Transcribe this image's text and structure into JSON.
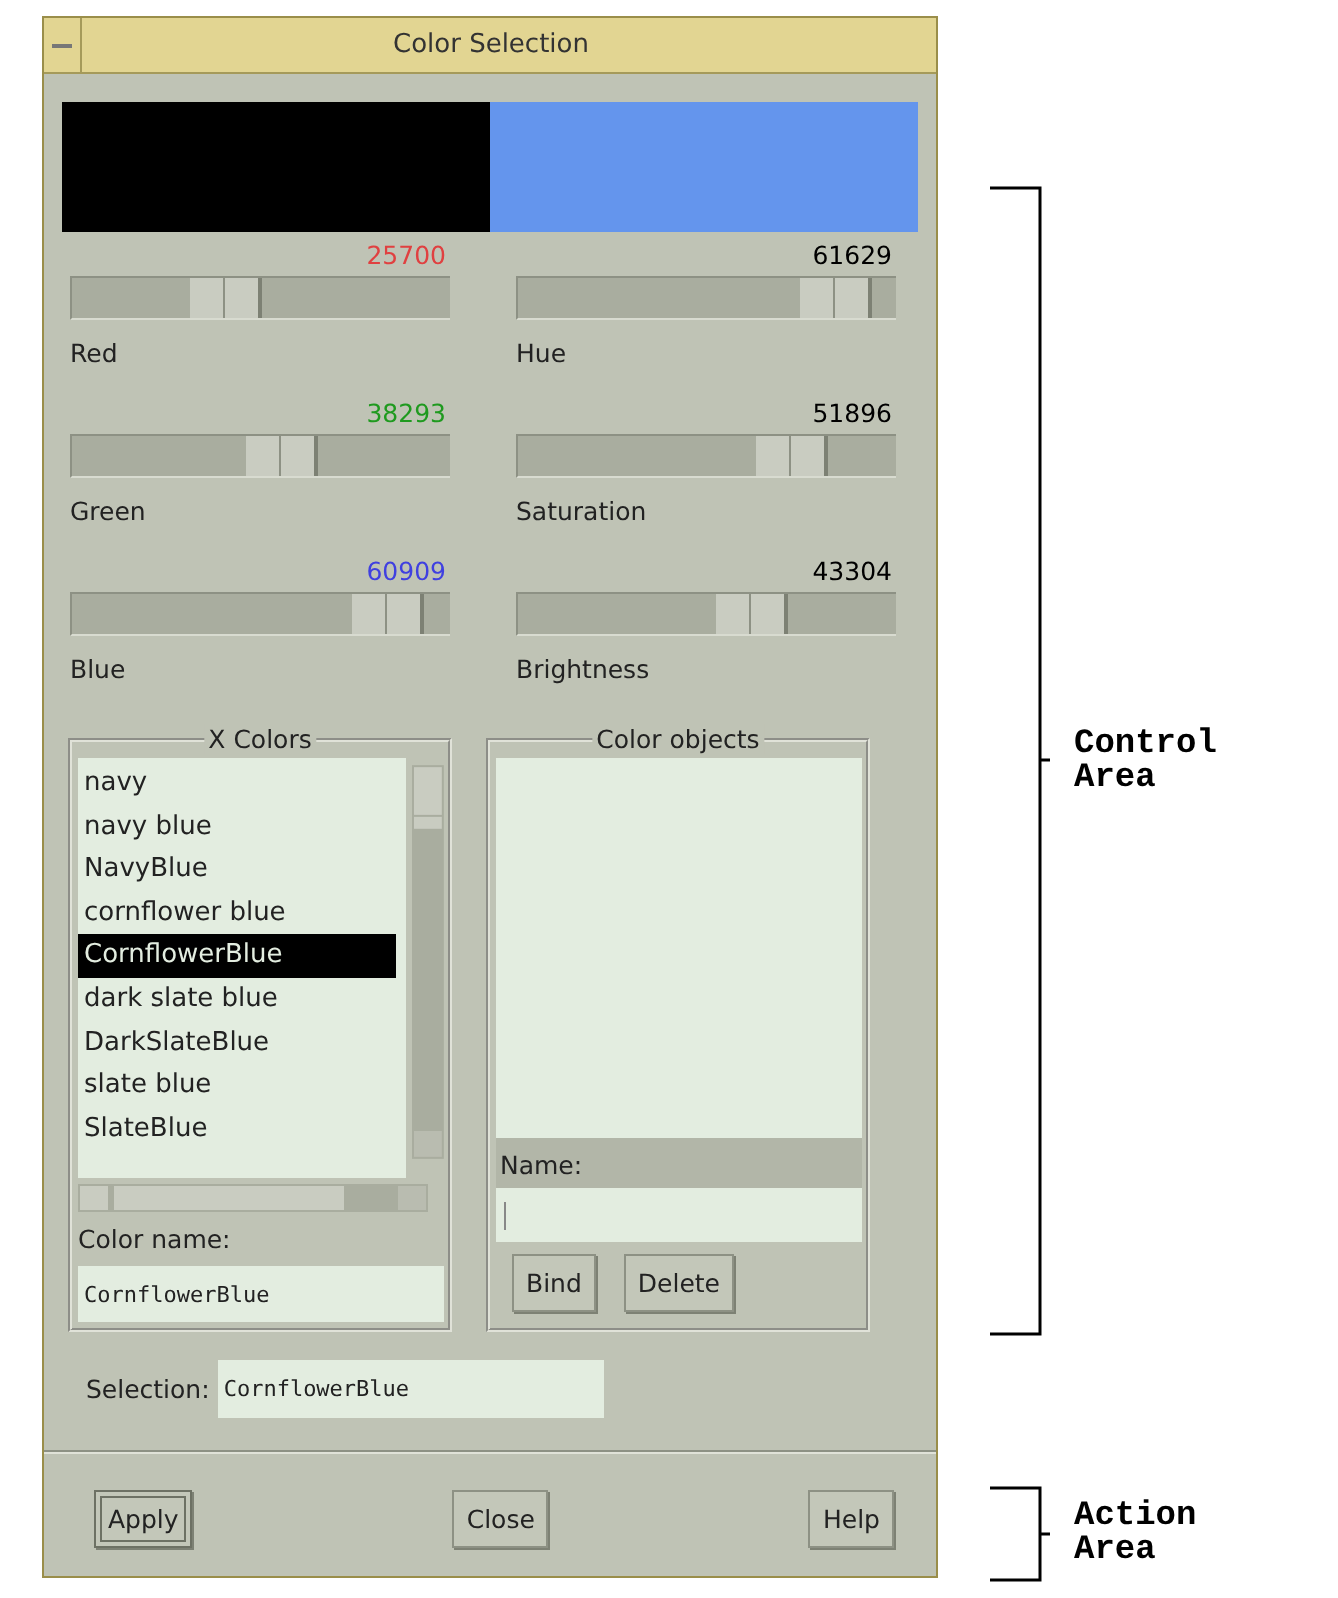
{
  "window": {
    "title": "Color Selection"
  },
  "swatches": [
    {
      "color": "#000000"
    },
    {
      "color": "#6495ed"
    }
  ],
  "sliders": [
    {
      "reading": "25700",
      "label": "Red",
      "level": 0.39,
      "color": "#e04040"
    },
    {
      "reading": "61629",
      "label": "Hue",
      "level": 0.94,
      "color": "#000000"
    },
    {
      "reading": "38293",
      "label": "Green",
      "level": 0.58,
      "color": "#1f9a1f"
    },
    {
      "reading": "51896",
      "label": "Saturation",
      "level": 0.79,
      "color": "#000000"
    },
    {
      "reading": "60909",
      "label": "Blue",
      "level": 0.93,
      "color": "#4040e0"
    },
    {
      "reading": "43304",
      "label": "Brightness",
      "level": 0.66,
      "color": "#000000"
    }
  ],
  "x_colors": {
    "title": "X Colors",
    "items": [
      {
        "label": "navy",
        "selected": false
      },
      {
        "label": "navy blue",
        "selected": false
      },
      {
        "label": "NavyBlue",
        "selected": false
      },
      {
        "label": "cornflower blue",
        "selected": false
      },
      {
        "label": "CornflowerBlue",
        "selected": true
      },
      {
        "label": "dark slate blue",
        "selected": false
      },
      {
        "label": "DarkSlateBlue",
        "selected": false
      },
      {
        "label": "slate blue",
        "selected": false
      },
      {
        "label": "SlateBlue",
        "selected": false
      }
    ],
    "color_name_label": "Color name:",
    "color_name_value": "CornflowerBlue"
  },
  "color_objects": {
    "title": "Color objects",
    "name_label": "Name:",
    "buttons": [
      "Bind",
      "Delete"
    ]
  },
  "selection": {
    "label": "Selection:",
    "value": "CornflowerBlue"
  },
  "buttons": [
    {
      "label": "Apply",
      "default": true
    },
    {
      "label": "Close",
      "default": false
    },
    {
      "label": "Help",
      "default": false
    }
  ],
  "annotations": [
    {
      "label": "Control Area"
    },
    {
      "label": "Action Area"
    }
  ]
}
